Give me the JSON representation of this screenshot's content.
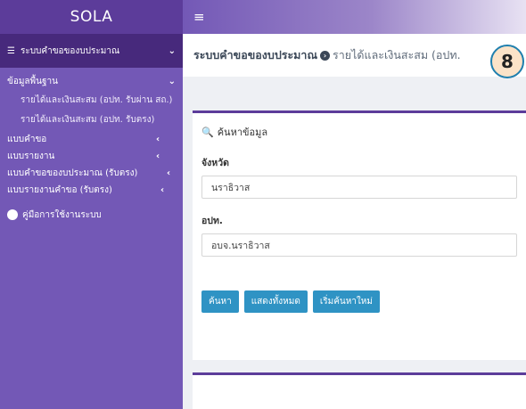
{
  "brand": "SOLA",
  "sidebar": {
    "main_menu": "ระบบคำขอของบประมาณ",
    "group_title": "ข้อมูลพื้นฐาน",
    "sub_items": [
      "รายได้และเงินสะสม (อปท. รับผ่าน สถ.)",
      "รายได้และเงินสะสม (อปท. รับตรง)"
    ],
    "items": [
      {
        "label": "แบบคำขอ"
      },
      {
        "label": "แบบรายงาน"
      },
      {
        "label": "แบบคำขอของบประมาณ (รับตรง)"
      },
      {
        "label": "แบบรายงานคำขอ (รับตรง)"
      }
    ],
    "manual": "คู่มือการใช้งานระบบ"
  },
  "header": {
    "title": "ระบบคำขอของบประมาณ",
    "subtitle": "รายได้และเงินสะสม (อปท."
  },
  "search": {
    "title": "ค้นหาข้อมูล",
    "province_label": "จังหวัด",
    "province_value": "นราธิวาส",
    "lao_label": "อปท.",
    "lao_value": "อบจ.นราธิวาส",
    "buttons": {
      "search": "ค้นหา",
      "show_all": "แสดงทั้งหมด",
      "reset": "เริ่มค้นหาใหม่"
    }
  },
  "step_badge": "8",
  "colors": {
    "sidebar": "#7358b6",
    "sidebar_active": "#47297c",
    "accent_button": "#2f93c4"
  }
}
